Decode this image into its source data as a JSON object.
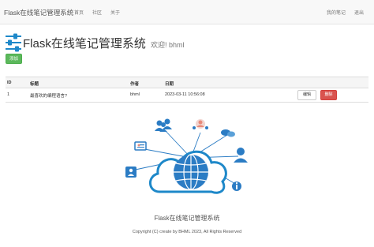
{
  "navbar": {
    "brand": "Flask在线笔记管理系统",
    "links": [
      "首页",
      "社区",
      "关于"
    ],
    "right": [
      "我的笔记",
      "退出"
    ]
  },
  "header": {
    "title": "Flask在线笔记管理系统",
    "welcome": "欢迎! bhml"
  },
  "toolbar": {
    "add_label": "添加"
  },
  "table": {
    "headers": [
      "ID",
      "标题",
      "作者",
      "日期"
    ],
    "rows": [
      {
        "id": "1",
        "title": "最喜欢的编程语言?",
        "author": "bhml",
        "date": "2023-03-11 10:56:08",
        "edit": "编辑",
        "delete": "删除"
      }
    ]
  },
  "footer": {
    "title": "Flask在线笔记管理系统",
    "copyright": "Copyright (C) create by BHML 2023, All Rights Reserved"
  },
  "colors": {
    "accent_blue": "#1e88c9",
    "success": "#5cb85c",
    "danger": "#d9534f",
    "navbar_bg": "#f8f8f8"
  },
  "icons": [
    "sliders-icon",
    "cloud-network-icon",
    "globe-icon",
    "user-group-icon",
    "chat-icon",
    "user-icon",
    "info-icon",
    "contact-card-icon",
    "monitor-icon"
  ]
}
